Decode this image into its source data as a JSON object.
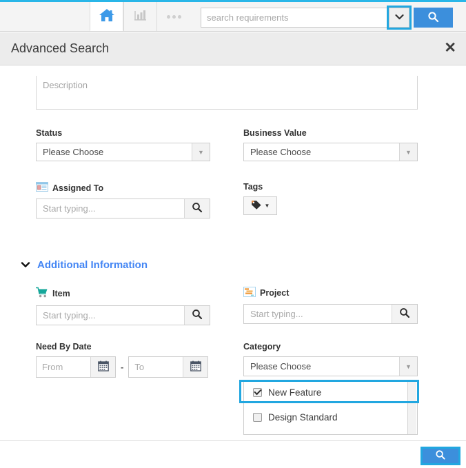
{
  "accent": {
    "cyan": "#22a7e0",
    "blue": "#3c8fdc",
    "link_blue": "#4486f4",
    "header_bg": "#ececec"
  },
  "topbar": {
    "home_icon": "home-icon",
    "reports_icon": "bar-chart-icon",
    "more_icon": "ellipsis-icon",
    "search": {
      "placeholder": "search requirements",
      "value": "",
      "caret_icon": "chevron-down-icon",
      "go_icon": "search-icon"
    }
  },
  "modal": {
    "title": "Advanced Search",
    "close_label": "✕"
  },
  "form": {
    "description": {
      "placeholder": "Description",
      "value": ""
    },
    "status": {
      "label": "Status",
      "value": "Please Choose",
      "arrow_icon": "triangle-down-icon"
    },
    "business_value": {
      "label": "Business Value",
      "value": "Please Choose",
      "arrow_icon": "triangle-down-icon"
    },
    "assigned_to": {
      "label": "Assigned To",
      "icon": "vcard-icon",
      "placeholder": "Start typing...",
      "value": "",
      "button_icon": "search-icon"
    },
    "tags": {
      "label": "Tags",
      "icon": "tag-icon",
      "caret_icon": "triangle-down-icon"
    }
  },
  "additional": {
    "section_title": "Additional Information",
    "caret_icon": "chevron-down-icon",
    "item": {
      "label": "Item",
      "icon": "shopping-cart-icon",
      "placeholder": "Start typing...",
      "value": "",
      "button_icon": "search-icon"
    },
    "project": {
      "label": "Project",
      "icon": "gantt-chart-icon",
      "placeholder": "Start typing...",
      "value": "",
      "button_icon": "search-icon"
    },
    "need_by_date": {
      "label": "Need By Date",
      "from_placeholder": "From",
      "from_value": "",
      "to_placeholder": "To",
      "to_value": "",
      "separator": "-",
      "calendar_icon": "calendar-icon"
    },
    "category": {
      "label": "Category",
      "value": "Please Choose",
      "arrow_icon": "triangle-down-icon",
      "expanded": true,
      "options": [
        {
          "label": "New Feature",
          "checked": true,
          "highlighted": true
        },
        {
          "label": "Design Standard",
          "checked": false,
          "highlighted": false
        }
      ]
    }
  },
  "footer": {
    "search_icon": "search-icon",
    "search_highlighted": true
  }
}
